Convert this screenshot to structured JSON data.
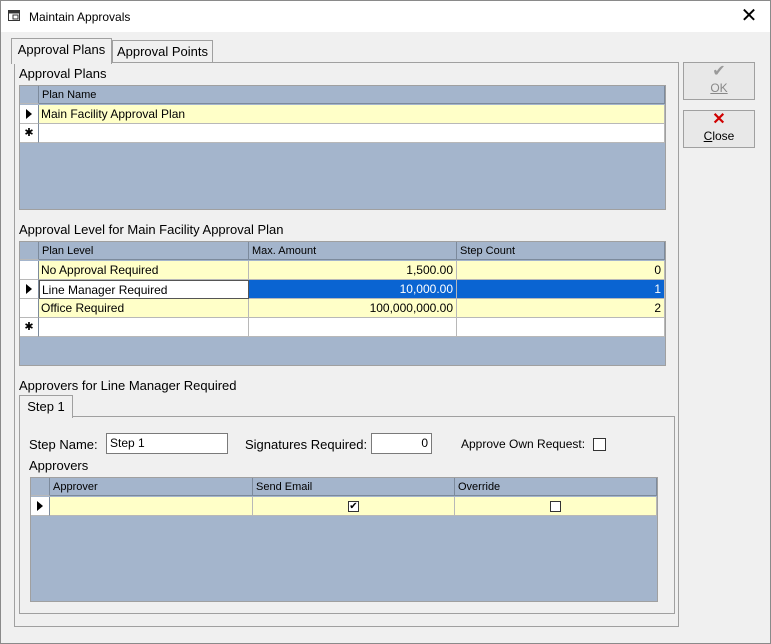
{
  "window": {
    "title": "Maintain Approvals",
    "close_glyph": "✕"
  },
  "tabs": [
    {
      "label": "Approval Plans"
    },
    {
      "label": "Approval Points"
    }
  ],
  "buttons": {
    "ok": "OK",
    "close": "Close"
  },
  "plans_section": {
    "title": "Approval Plans",
    "columns": [
      "Plan Name"
    ],
    "rows": [
      {
        "name": "Main Facility Approval Plan"
      }
    ],
    "new_row_marker": "✱"
  },
  "levels_section": {
    "title": "Approval Level for Main Facility Approval Plan",
    "columns": [
      "Plan Level",
      "Max. Amount",
      "Step Count"
    ],
    "rows": [
      {
        "level": "No Approval Required",
        "amount": "1,500.00",
        "steps": "0"
      },
      {
        "level": "Line Manager Required",
        "amount": "10,000.00",
        "steps": "1"
      },
      {
        "level": "Office Required",
        "amount": "100,000,000.00",
        "steps": "2"
      }
    ],
    "new_row_marker": "✱"
  },
  "approvers_section": {
    "title": "Approvers for Line Manager Required",
    "step_tab": "Step 1",
    "step_name_label": "Step Name:",
    "step_name_value": "Step 1",
    "signatures_label": "Signatures Required:",
    "signatures_value": "0",
    "approve_own_label": "Approve Own Request:",
    "approve_own_checked": false,
    "approvers_label": "Approvers",
    "columns": [
      "Approver",
      "Send Email",
      "Override"
    ],
    "rows": [
      {
        "approver": "",
        "send_email": true,
        "override": false
      }
    ]
  },
  "colors": {
    "grid_bg": "#a4b5cc",
    "row_yellow": "#ffffc8",
    "selection": "#0a64d2",
    "close_red": "#d00000"
  },
  "icons": [
    "window-icon",
    "check-icon",
    "x-icon",
    "row-pointer-icon",
    "new-row-icon"
  ]
}
